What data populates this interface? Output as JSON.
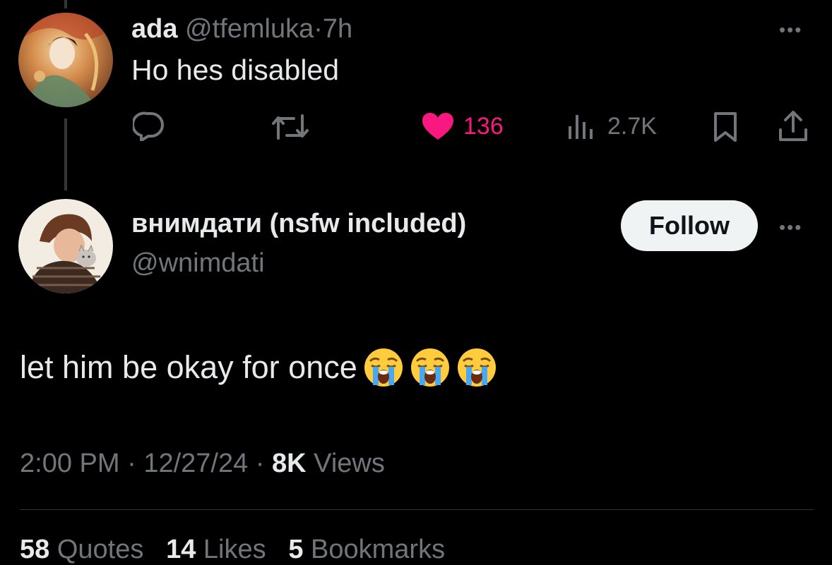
{
  "reply": {
    "display_name": "ada",
    "handle": "@tfemluka",
    "separator": "·",
    "time": "7h",
    "text": "Ho hes disabled",
    "more": "•••",
    "actions": {
      "like_count": "136",
      "views_count": "2.7K"
    },
    "colors": {
      "like": "#f91880",
      "muted": "#71767b"
    }
  },
  "main_post": {
    "display_name": "внимдати (nsfw included)",
    "handle": "@wnimdati",
    "follow_label": "Follow",
    "more": "•••",
    "text": "let him be okay for once",
    "emojis": [
      "loudly-crying-face",
      "loudly-crying-face",
      "loudly-crying-face"
    ],
    "time": "2:00 PM",
    "date": "12/27/24",
    "separator": "·",
    "views_count": "8K",
    "views_label": "Views",
    "stats": [
      {
        "count": "58",
        "label": "Quotes"
      },
      {
        "count": "14",
        "label": "Likes"
      },
      {
        "count": "5",
        "label": "Bookmarks"
      }
    ]
  }
}
